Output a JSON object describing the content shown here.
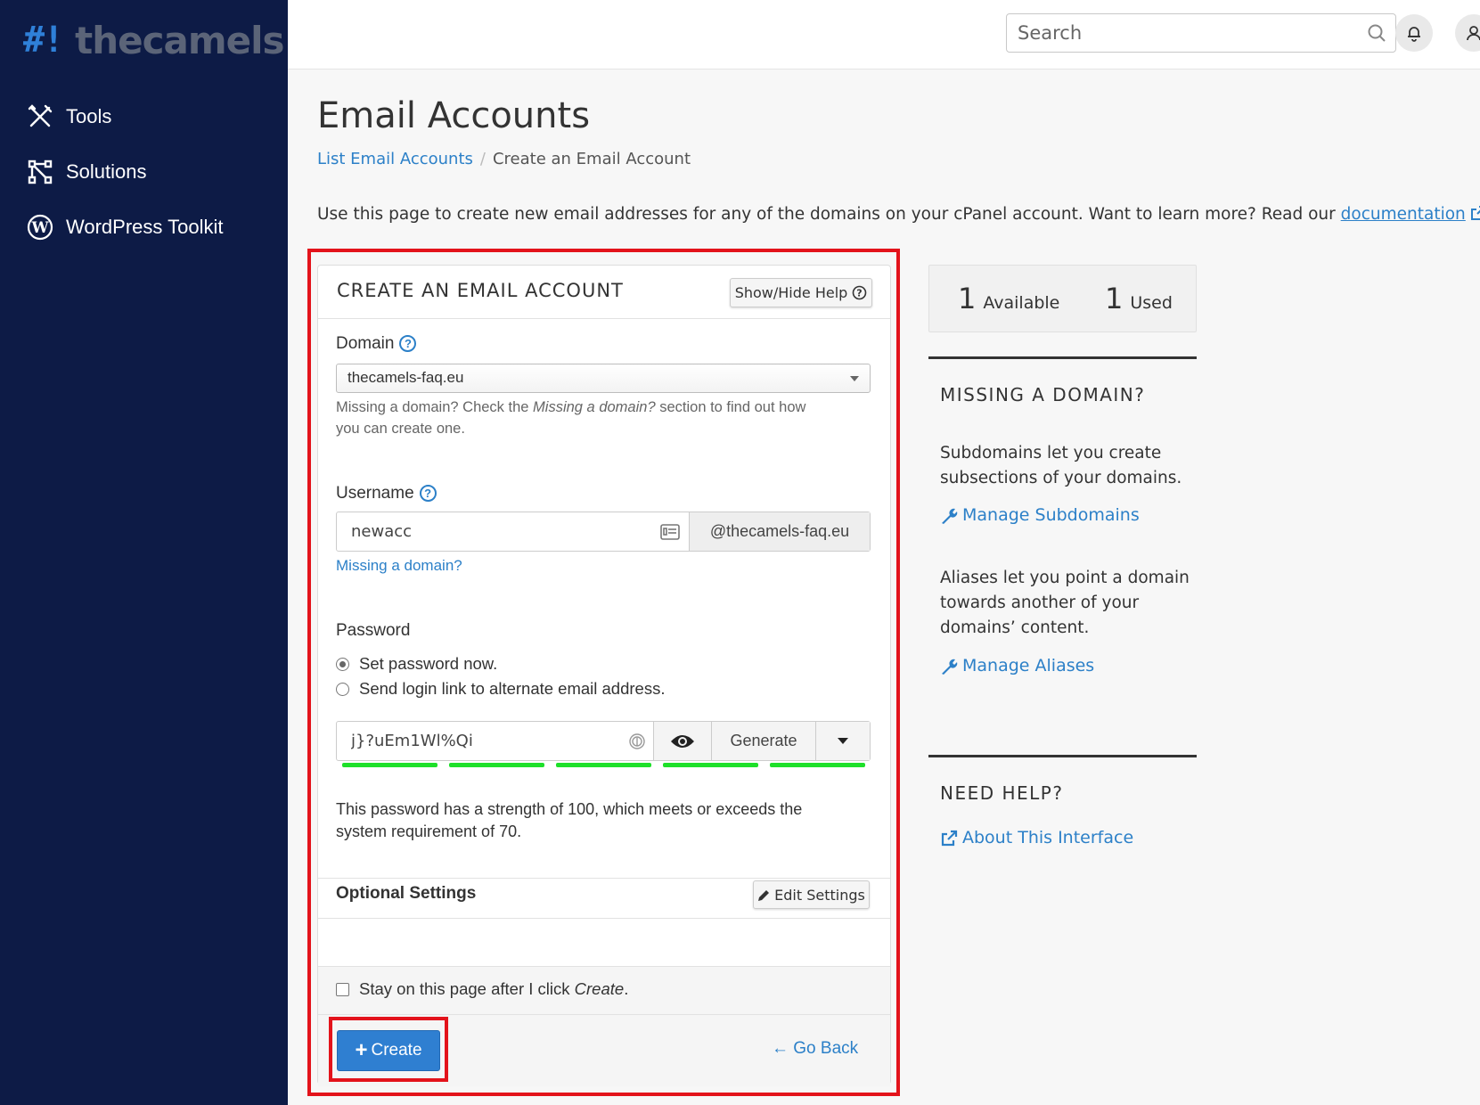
{
  "brand": {
    "hash": "#!",
    "name": "thecamels"
  },
  "sidebar": {
    "items": [
      {
        "label": "Tools",
        "icon": "tools-icon"
      },
      {
        "label": "Solutions",
        "icon": "solutions-icon"
      },
      {
        "label": "WordPress Toolkit",
        "icon": "wordpress-icon"
      }
    ]
  },
  "header": {
    "search_placeholder": "Search"
  },
  "page": {
    "title": "Email Accounts",
    "breadcrumb": {
      "link": "List Email Accounts",
      "separator": "/",
      "current": "Create an Email Account"
    },
    "intro": "Use this page to create new email addresses for any of the domains on your cPanel account. Want to learn more? Read our",
    "intro_link": "documentation",
    "intro_end": "."
  },
  "form": {
    "title": "CREATE AN EMAIL ACCOUNT",
    "help_button": "Show/Hide Help",
    "domain_label": "Domain",
    "domain_value": "thecamels-faq.eu",
    "domain_hint_1": "Missing a domain? Check the",
    "domain_hint_em": "Missing a domain?",
    "domain_hint_2": "section to find out how",
    "domain_hint_3": "you can create one.",
    "username_label": "Username",
    "username_value": "newacc",
    "username_suffix": "@thecamels-faq.eu",
    "missing_domain_link": "Missing a domain?",
    "password_label": "Password",
    "radio_set_now": "Set password now.",
    "radio_send_link": "Send login link to alternate email address.",
    "password_value": "j}?uEm1Wl%Qi",
    "generate_label": "Generate",
    "strength_segments": 5,
    "strength_text_1": "This password has a strength of 100, which meets or exceeds the",
    "strength_text_2": "system requirement of 70.",
    "optional_settings": "Optional Settings",
    "edit_settings": "Edit Settings",
    "stay_text": "Stay on this page after I click",
    "stay_em": "Create",
    "stay_end": ".",
    "create_button": "Create",
    "go_back": "Go Back"
  },
  "stats": {
    "available_num": "1",
    "available_label": "Available",
    "used_num": "1",
    "used_label": "Used"
  },
  "missing_domain": {
    "title": "MISSING A DOMAIN?",
    "text1_line1": "Subdomains let you create",
    "text1_line2": "subsections of your domains.",
    "link1": "Manage Subdomains",
    "text2_line1": "Aliases let you point a domain",
    "text2_line2": "towards another of your",
    "text2_line3": "domains’ content.",
    "link2": "Manage Aliases"
  },
  "need_help": {
    "title": "NEED HELP?",
    "link": "About This Interface"
  },
  "colors": {
    "sidebar": "#0d1b46",
    "accent": "#2c80c8",
    "primary_button": "#2f7fd1",
    "strength": "#1ee02a",
    "highlight": "#e3131b"
  }
}
